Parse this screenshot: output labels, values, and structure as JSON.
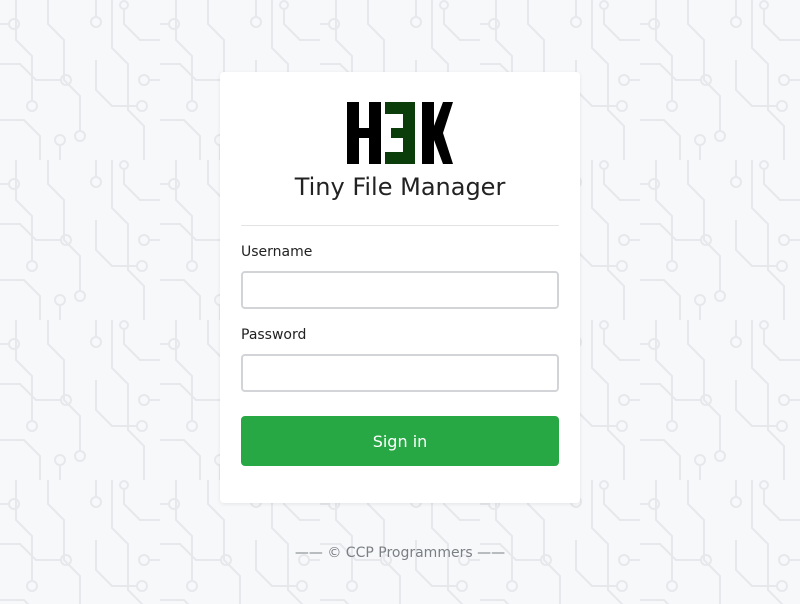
{
  "app": {
    "logo_text": "H3K",
    "title": "Tiny File Manager"
  },
  "login_form": {
    "username_label": "Username",
    "username_value": "",
    "password_label": "Password",
    "password_value": "",
    "submit_label": "Sign in"
  },
  "footer": {
    "text": "—— © CCP Programmers ——"
  },
  "colors": {
    "background": "#f7f8fa",
    "card": "#ffffff",
    "primary_button": "#28a745",
    "logo_black": "#000000",
    "logo_green": "#0b3d0b",
    "footer_text": "#7b7f83"
  }
}
